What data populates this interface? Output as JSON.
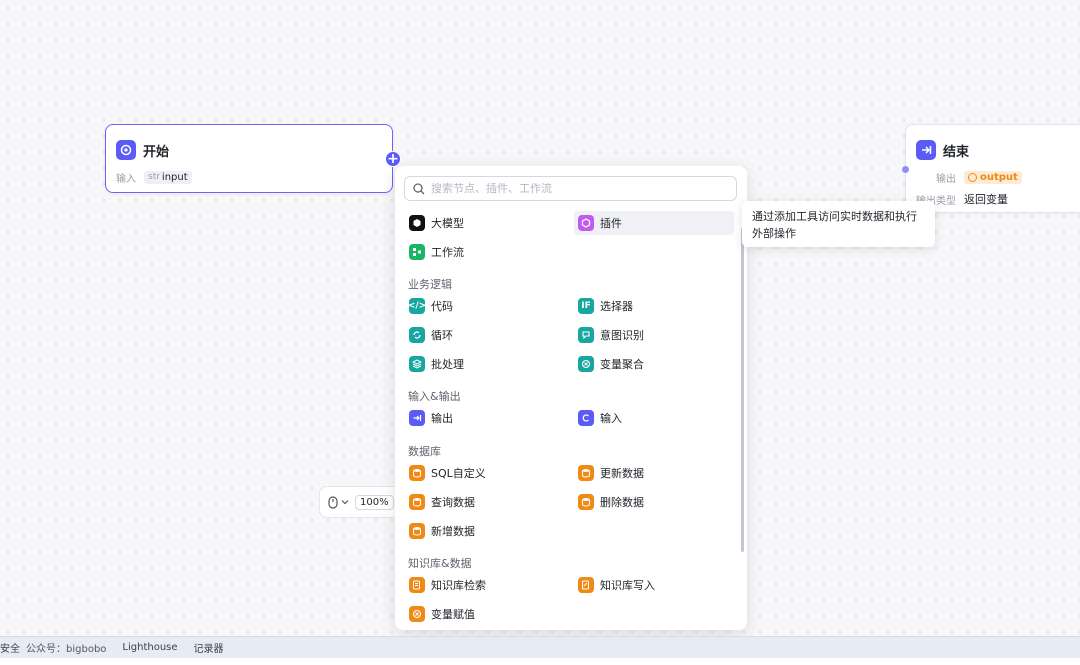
{
  "start_node": {
    "title": "开始",
    "input_label": "输入",
    "input_type": "str",
    "input_name": "input"
  },
  "end_node": {
    "title": "结束",
    "output_label": "输出",
    "output_name": "output",
    "output_type_label": "输出类型",
    "output_type_value": "返回变量"
  },
  "add_button": "+",
  "menu": {
    "search_placeholder": "搜索节点、插件、工作流",
    "top_items": [
      {
        "label": "大模型",
        "icon": "llm-icon"
      },
      {
        "label": "插件",
        "icon": "plugin-icon"
      },
      {
        "label": "工作流",
        "icon": "workflow-icon"
      }
    ],
    "sections": [
      {
        "title": "业务逻辑",
        "items": [
          "代码",
          "选择器",
          "循环",
          "意图识别",
          "批处理",
          "变量聚合"
        ]
      },
      {
        "title": "输入&输出",
        "items": [
          "输出",
          "输入"
        ]
      },
      {
        "title": "数据库",
        "items": [
          "SQL自定义",
          "更新数据",
          "查询数据",
          "删除数据",
          "新增数据"
        ]
      },
      {
        "title": "知识库&数据",
        "items": [
          "知识库检索",
          "知识库写入",
          "变量赋值"
        ]
      }
    ]
  },
  "tooltip": {
    "line1": "通过添加工具访问实时数据和执行",
    "line2": "外部操作"
  },
  "zoom": {
    "value": "100%"
  },
  "bottom_bar": {
    "items": [
      "安全",
      "公众号：bigbobo",
      "Lighthouse",
      "记录器"
    ]
  },
  "colors": {
    "accent": "#5b5bf7",
    "teal": "#17a7a0",
    "orange": "#f08a16",
    "green": "#18b566",
    "purple": "#c15af0"
  }
}
